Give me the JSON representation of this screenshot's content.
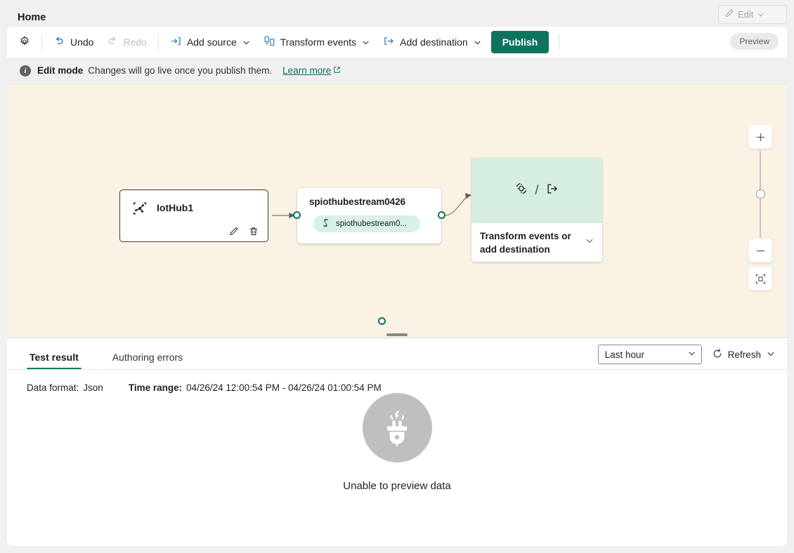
{
  "tabstrip": {
    "home_tab": "Home",
    "edit_button": {
      "label": "Edit",
      "icon": "pencil-icon",
      "chevron": "chevron-down-icon",
      "disabled": true
    }
  },
  "commandbar": {
    "settings_icon": "gear-icon",
    "undo": "Undo",
    "redo": "Redo",
    "add_source": "Add source",
    "transform_events": "Transform events",
    "add_destination": "Add destination",
    "publish": "Publish",
    "preview_badge": "Preview",
    "accent_color": "#0f7360"
  },
  "infobar": {
    "icon": "info-icon",
    "title": "Edit mode",
    "message": "Changes will go live once you publish them.",
    "link": "Learn more",
    "link_icon": "external-link-icon"
  },
  "canvas": {
    "background_color": "#faf2e3",
    "nodes": {
      "source": {
        "name": "IotHub1",
        "icon": "iot-hub-icon",
        "edit_action": "edit-icon",
        "delete_action": "delete-icon"
      },
      "stream": {
        "title": "spiothubestream0426",
        "pill_label": "spiothubestream0...",
        "pill_icon": "eventstream-icon"
      },
      "destination": {
        "icon_transform": "transform-icon",
        "separator": "/",
        "icon_destination": "destination-icon",
        "label": "Transform events or add destination",
        "chevron": "chevron-down-icon"
      }
    },
    "zoom_controls": {
      "zoom_in": "+",
      "zoom_out": "−",
      "fit_to_screen": "fit-to-screen-icon"
    }
  },
  "bottom_panel": {
    "tabs": [
      {
        "label": "Test result",
        "active": true
      },
      {
        "label": "Authoring errors",
        "active": false
      }
    ],
    "time_range_select": {
      "value": "Last hour",
      "chevron": "chevron-down-icon"
    },
    "refresh": {
      "label": "Refresh",
      "icon": "refresh-icon",
      "chevron": "chevron-down-icon"
    },
    "meta": {
      "data_format_label": "Data format:",
      "data_format_value": "Json",
      "time_range_label": "Time range:",
      "time_range_value": "04/26/24 12:00:54 PM - 04/26/24 01:00:54 PM"
    },
    "empty_state": {
      "icon": "plug-icon",
      "message": "Unable to preview data"
    }
  }
}
